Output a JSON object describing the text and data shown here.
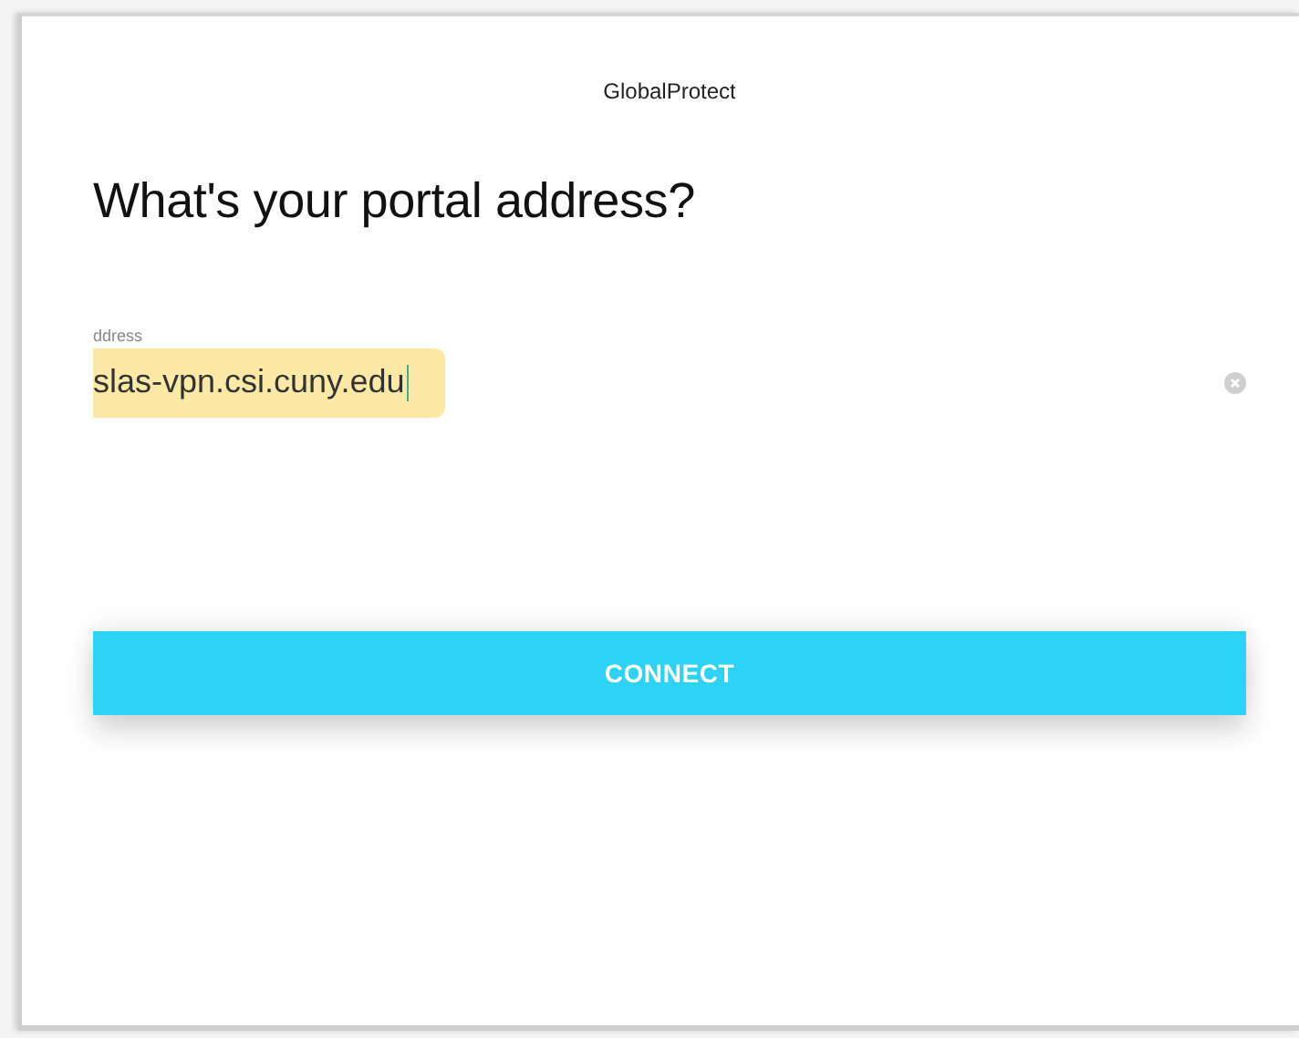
{
  "window": {
    "title": "GlobalProtect"
  },
  "heading": "What's your portal address?",
  "address_field": {
    "label": "ddress",
    "value": "slas-vpn.csi.cuny.edu",
    "highlighted": true
  },
  "buttons": [
    {
      "label": "CONNECT"
    }
  ]
}
